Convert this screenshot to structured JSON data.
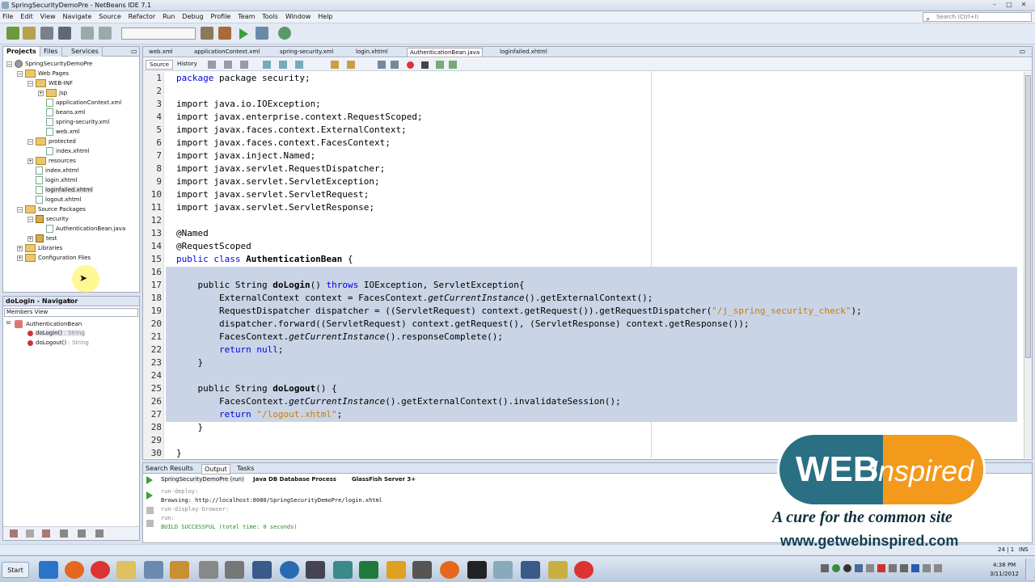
{
  "window": {
    "title": "SpringSecurityDemoPre - NetBeans IDE 7.1"
  },
  "menu": [
    "File",
    "Edit",
    "View",
    "Navigate",
    "Source",
    "Refactor",
    "Run",
    "Debug",
    "Profile",
    "Team",
    "Tools",
    "Window",
    "Help"
  ],
  "search": {
    "placeholder": "Search (Ctrl+I)"
  },
  "projects": {
    "tabs": [
      "Projects",
      "Files",
      "Services"
    ],
    "tree": [
      {
        "label": "SpringSecurityDemoPre",
        "depth": 0,
        "kind": "project"
      },
      {
        "label": "Web Pages",
        "depth": 1,
        "kind": "folder"
      },
      {
        "label": "WEB-INF",
        "depth": 2,
        "kind": "folder"
      },
      {
        "label": "jsp",
        "depth": 3,
        "kind": "folder"
      },
      {
        "label": "applicationContext.xml",
        "depth": 3,
        "kind": "file"
      },
      {
        "label": "beans.xml",
        "depth": 3,
        "kind": "file"
      },
      {
        "label": "spring-security.xml",
        "depth": 3,
        "kind": "file"
      },
      {
        "label": "web.xml",
        "depth": 3,
        "kind": "file"
      },
      {
        "label": "protected",
        "depth": 2,
        "kind": "folder"
      },
      {
        "label": "index.xhtml",
        "depth": 3,
        "kind": "file"
      },
      {
        "label": "resources",
        "depth": 2,
        "kind": "folder"
      },
      {
        "label": "index.xhtml",
        "depth": 2,
        "kind": "file"
      },
      {
        "label": "login.xhtml",
        "depth": 2,
        "kind": "file"
      },
      {
        "label": "loginfailed.xhtml",
        "depth": 2,
        "kind": "file"
      },
      {
        "label": "logout.xhtml",
        "depth": 2,
        "kind": "file"
      },
      {
        "label": "Source Packages",
        "depth": 1,
        "kind": "folder"
      },
      {
        "label": "security",
        "depth": 2,
        "kind": "package"
      },
      {
        "label": "AuthenticationBean.java",
        "depth": 3,
        "kind": "file"
      },
      {
        "label": "test",
        "depth": 2,
        "kind": "package"
      },
      {
        "label": "Libraries",
        "depth": 1,
        "kind": "folder"
      },
      {
        "label": "Configuration Files",
        "depth": 1,
        "kind": "folder"
      }
    ]
  },
  "navigator": {
    "title": "doLogin - Navigator",
    "view": "Members View",
    "class": "AuthenticationBean",
    "members": [
      {
        "name": "doLogin()",
        "type": " : String"
      },
      {
        "name": "doLogout()",
        "type": " : String"
      }
    ]
  },
  "editor": {
    "tabs": [
      "web.xml",
      "applicationContext.xml",
      "spring-security.xml",
      "login.xhtml",
      "AuthenticationBean.java",
      "loginfailed.xhtml"
    ],
    "active_tab": "AuthenticationBean.java",
    "subtabs": [
      "Source",
      "History"
    ],
    "line_numbers": [
      "1",
      "2",
      "3",
      "4",
      "5",
      "6",
      "7",
      "8",
      "9",
      "10",
      "11",
      "12",
      "13",
      "14",
      "15",
      "16",
      "17",
      "18",
      "19",
      "20",
      "21",
      "22",
      "23",
      "24",
      "25",
      "26",
      "27",
      "28",
      "29",
      "30"
    ],
    "code": {
      "l1": "package security;",
      "l3": "import java.io.IOException;",
      "l4": "import javax.enterprise.context.RequestScoped;",
      "l5": "import javax.faces.context.ExternalContext;",
      "l6": "import javax.faces.context.FacesContext;",
      "l7": "import javax.inject.Named;",
      "l8": "import javax.servlet.RequestDispatcher;",
      "l9": "import javax.servlet.ServletException;",
      "l10": "import javax.servlet.ServletRequest;",
      "l11": "import javax.servlet.ServletResponse;",
      "l13": "@Named",
      "l14": "@RequestScoped",
      "l15a": "public class ",
      "l15b": "AuthenticationBean",
      "l15c": " {",
      "l17a": "    public String ",
      "l17b": "doLogin",
      "l17c": "() ",
      "l17d": "throws",
      "l17e": " IOException, ServletException{",
      "l18a": "        ExternalContext context = FacesContext.",
      "l18b": "getCurrentInstance",
      "l18c": "().getExternalContext();",
      "l19a": "        RequestDispatcher dispatcher = ((ServletRequest) context.getRequest()).getRequestDispatcher(",
      "l19b": "\"/j_spring_security_check\"",
      "l19c": ");",
      "l20": "        dispatcher.forward((ServletRequest) context.getRequest(), (ServletResponse) context.getResponse());",
      "l21a": "        FacesContext.",
      "l21b": "getCurrentInstance",
      "l21c": "().responseComplete();",
      "l22a": "        ",
      "l22b": "return null",
      "l22c": ";",
      "l23": "    }",
      "l25a": "    public String ",
      "l25b": "doLogout",
      "l25c": "() {",
      "l26a": "        FacesContext.",
      "l26b": "getCurrentInstance",
      "l26c": "().getExternalContext().invalidateSession();",
      "l27a": "        return ",
      "l27b": "\"/logout.xhtml\"",
      "l27c": ";",
      "l28": "    }",
      "l30": "}"
    }
  },
  "output": {
    "tabs": [
      "Search Results",
      "Output",
      "Tasks"
    ],
    "subtabs": [
      "SpringSecurityDemoPre (run)",
      "Java DB Database Process",
      "GlassFish Server 3+"
    ],
    "lines": [
      "run-deploy:",
      "Browsing: http://localhost:8080/SpringSecurityDemoPre/login.xhtml",
      "run-display-browser:",
      "run:",
      "BUILD SUCCESSFUL (total time: 0 seconds)"
    ]
  },
  "status": {
    "position": "24 | 1",
    "mode": "INS"
  },
  "taskbar": {
    "start": "Start",
    "time": "4:38 PM",
    "date": "3/11/2012"
  },
  "watermark": {
    "brand_a": "WEB",
    "brand_b": "Inspired",
    "tagline": "A cure for the common site",
    "url": "www.getwebinspired.com"
  },
  "colors": {
    "keyword": "#0000e6",
    "string": "#ce7b00",
    "selection": "#c9d4e6",
    "brand_teal": "#2a6f82",
    "brand_orange": "#f39a1d"
  }
}
